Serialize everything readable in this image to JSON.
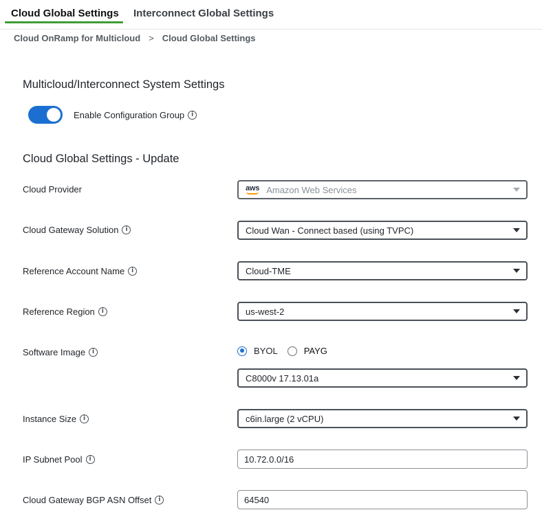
{
  "tabs": [
    {
      "label": "Cloud Global Settings",
      "active": true
    },
    {
      "label": "Interconnect Global Settings",
      "active": false
    }
  ],
  "accent_color": "#3f9c35",
  "toggle_color": "#1b6fd1",
  "breadcrumb": {
    "parent": "Cloud OnRamp for Multicloud",
    "separator": ">",
    "current": "Cloud Global Settings"
  },
  "system_settings": {
    "title": "Multicloud/Interconnect System Settings",
    "toggle_label": "Enable Configuration Group",
    "toggle_on": true
  },
  "update_section": {
    "title": "Cloud Global Settings - Update"
  },
  "fields": {
    "cloud_provider": {
      "label": "Cloud Provider",
      "logo": "aws",
      "value": "Amazon Web Services"
    },
    "gateway_solution": {
      "label": "Cloud Gateway Solution",
      "value": "Cloud Wan - Connect based (using TVPC)"
    },
    "account_name": {
      "label": "Reference Account Name",
      "value": "Cloud-TME"
    },
    "region": {
      "label": "Reference Region",
      "value": "us-west-2"
    },
    "software_image": {
      "label": "Software Image",
      "options": [
        {
          "label": "BYOL",
          "checked": true
        },
        {
          "label": "PAYG",
          "checked": false
        }
      ],
      "value": "C8000v 17.13.01a"
    },
    "instance_size": {
      "label": "Instance Size",
      "value": "c6in.large (2 vCPU)"
    },
    "subnet_pool": {
      "label": "IP Subnet Pool",
      "value": "10.72.0.0/16"
    },
    "bgp_asn_offset": {
      "label": "Cloud Gateway BGP ASN Offset",
      "value": "64540"
    }
  },
  "icons": {
    "info": "i"
  }
}
